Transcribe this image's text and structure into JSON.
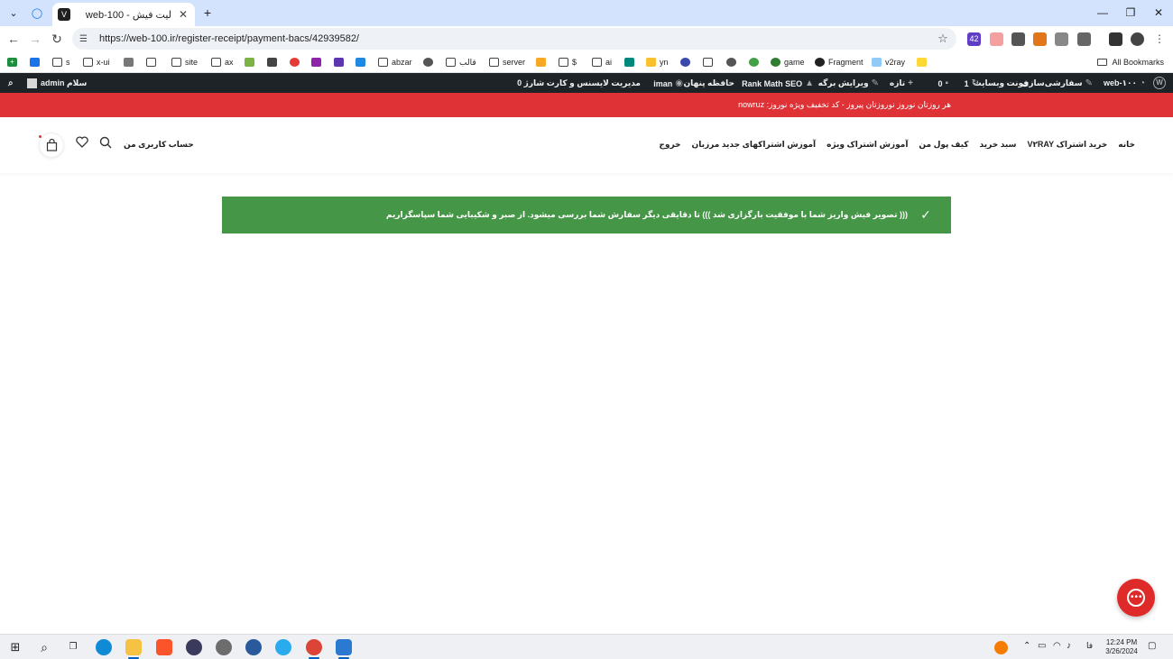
{
  "browser": {
    "tab_title": "لیت فیش - web-100",
    "tab_favicon": "V",
    "url": "https://web-100.ir/register-receipt/payment-bacs/42939582/",
    "extension_badge": "42"
  },
  "bookmarks": {
    "items": [
      "s",
      "x-ui",
      "site",
      "ax",
      "abzar",
      "قالب",
      "server",
      "$",
      "ai",
      "yn",
      "game",
      "Fragment",
      "v2ray"
    ],
    "all_bookmarks": "All Bookmarks"
  },
  "admin_bar": {
    "site_name": "web-۱۰۰",
    "customize": "سفارشی‌سازی",
    "font": "فونت وبسایت",
    "updates_count": "1",
    "comments_count": "0",
    "new": "تازه",
    "edit_page": "ویرایش برگه",
    "rank_math": "Rank Math SEO",
    "cache": "حافظه پنهان",
    "user_iman": "iman",
    "license": "مدیریت لایسنس و کارت شارژ 0",
    "greeting": "سلام admin"
  },
  "promo": {
    "text": "هر روزتان نوروز نوروزتان پیروز - کد تخفیف ویژه نوروز: nowruz"
  },
  "header": {
    "nav": [
      "خانه",
      "خرید اشتراک V۲RAY",
      "سبد خرید",
      "کیف پول من",
      "آموزش اشتراک ویژه",
      "آموزش اشتراکهای جدید مرزبان",
      "خروج"
    ],
    "account": "حساب کاربری من"
  },
  "notice": {
    "message": "((( تصویر فیش واریز شما با موفقیت بارگزاری شد ))) تا دقایقی دیگر سفارش شما بررسی میشود. از صبر و شکیبایی شما سپاسگزاریم"
  },
  "taskbar": {
    "time": "12:24 PM",
    "date": "3/26/2024",
    "lang": "فا"
  },
  "colors": {
    "tabstrip": "#d3e3fd",
    "admin_bar": "#1d2327",
    "promo": "#df3236",
    "notice": "#459647",
    "chat": "#df2a2a"
  }
}
